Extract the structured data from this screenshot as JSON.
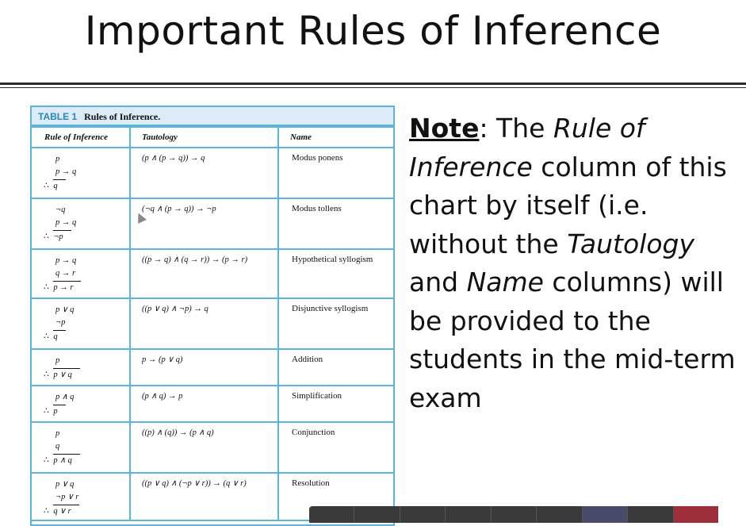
{
  "slide": {
    "title": "Important Rules of Inference"
  },
  "table": {
    "caption_number": "TABLE 1",
    "caption_title": "Rules of Inference.",
    "headers": [
      "Rule of Inference",
      "Tautology",
      "Name"
    ],
    "rows": [
      {
        "premises": [
          "p",
          "p → q"
        ],
        "conclusion": "q",
        "tautology": "(p ∧ (p → q)) → q",
        "name": "Modus ponens"
      },
      {
        "premises": [
          "¬q",
          "p → q"
        ],
        "conclusion": "¬p",
        "tautology": "(¬q ∧ (p → q)) → ¬p",
        "name": "Modus tollens"
      },
      {
        "premises": [
          "p → q",
          "q → r"
        ],
        "conclusion": "p → r",
        "tautology": "((p → q) ∧ (q → r)) → (p → r)",
        "name": "Hypothetical syllogism"
      },
      {
        "premises": [
          "p ∨ q",
          "¬p"
        ],
        "conclusion": "q",
        "tautology": "((p ∨ q) ∧ ¬p) → q",
        "name": "Disjunctive syllogism"
      },
      {
        "premises": [
          "p"
        ],
        "conclusion": "p ∨ q",
        "tautology": "p → (p ∨ q)",
        "name": "Addition"
      },
      {
        "premises": [
          "p ∧ q"
        ],
        "conclusion": "p",
        "tautology": "(p ∧ q) → p",
        "name": "Simplification"
      },
      {
        "premises": [
          "p",
          "q"
        ],
        "conclusion": "p ∧ q",
        "tautology": "((p) ∧ (q)) → (p ∧ q)",
        "name": "Conjunction"
      },
      {
        "premises": [
          "p ∨ q",
          "¬p ∨ r"
        ],
        "conclusion": "q ∨ r",
        "tautology": "((p ∨ q) ∧ (¬p ∨ r)) → (q ∨ r)",
        "name": "Resolution"
      }
    ],
    "therefore_symbol": "∴"
  },
  "note": {
    "label": "Note",
    "t1": ": The ",
    "i1": "Rule of Inference",
    "t2": " column of this chart by itself (i.e. without the ",
    "i2": "Tautology",
    "t3": " and ",
    "i3": "Name",
    "t4": " columns) will be provided to the students in the mid-term exam"
  },
  "colors": {
    "table_border": "#5ab4de",
    "caption_bg": "#dcebf5",
    "caption_number": "#2a86c0"
  }
}
